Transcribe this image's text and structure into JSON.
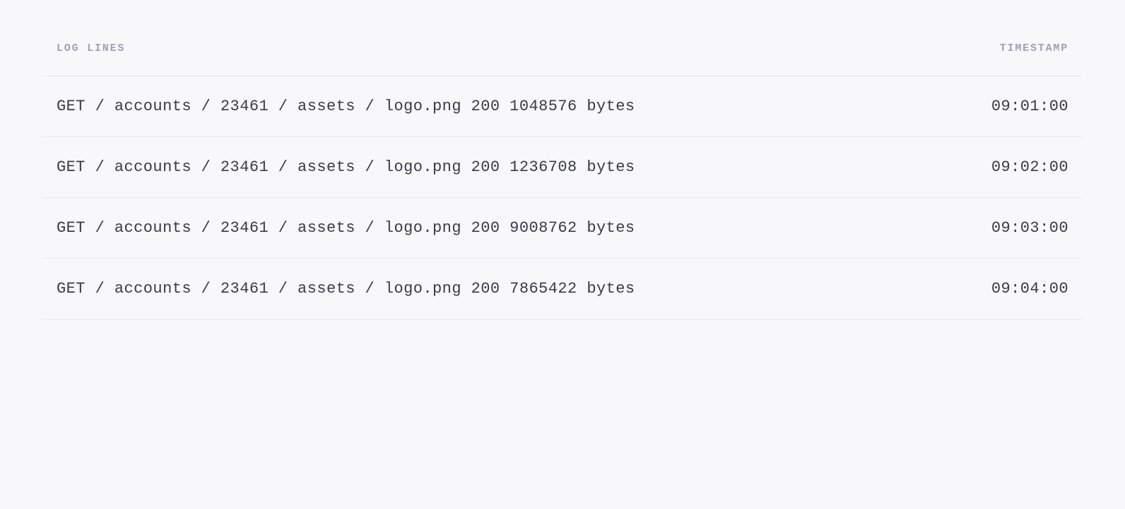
{
  "header": {
    "log_lines_label": "LOG LINES",
    "timestamp_label": "TIMESTAMP"
  },
  "logs": [
    {
      "line": "GET  /  accounts / 23461 / assets /  logo.png  200  1048576  bytes",
      "timestamp": "09:01:00"
    },
    {
      "line": "GET  /  accounts / 23461 / assets /  logo.png  200  1236708  bytes",
      "timestamp": "09:02:00"
    },
    {
      "line": "GET  /  accounts / 23461 / assets /  logo.png  200  9008762  bytes",
      "timestamp": "09:03:00"
    },
    {
      "line": "GET  /  accounts / 23461 / assets /  logo.png  200  7865422  bytes",
      "timestamp": "09:04:00"
    }
  ]
}
